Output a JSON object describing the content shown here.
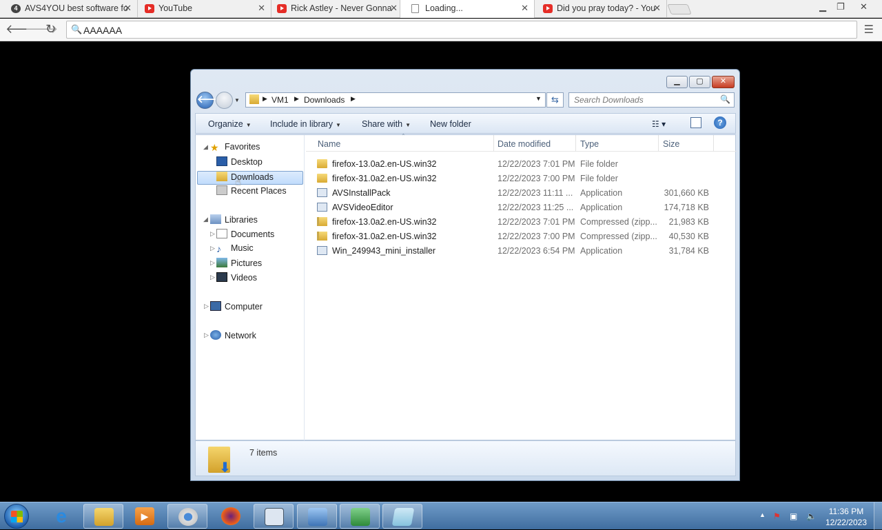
{
  "browser": {
    "tabs": [
      {
        "title": "AVS4YOU best software fo",
        "favicon": "avs-icon"
      },
      {
        "title": "YouTube",
        "favicon": "youtube-icon"
      },
      {
        "title": "Rick Astley - Never Gonna",
        "favicon": "youtube-icon"
      },
      {
        "title": "Loading...",
        "favicon": "document-icon"
      },
      {
        "title": "Did you pray today? - You",
        "favicon": "youtube-icon"
      }
    ],
    "active_tab": 3,
    "omnibox_value": "AAAAAA"
  },
  "explorer": {
    "breadcrumb": [
      "VM1",
      "Downloads"
    ],
    "search_placeholder": "Search Downloads",
    "commands": {
      "organize": "Organize",
      "include_in_library": "Include in library",
      "share_with": "Share with",
      "new_folder": "New folder"
    },
    "nav": {
      "favorites": "Favorites",
      "desktop": "Desktop",
      "downloads": "Downloads",
      "recent_places": "Recent Places",
      "libraries": "Libraries",
      "documents": "Documents",
      "music": "Music",
      "pictures": "Pictures",
      "videos": "Videos",
      "computer": "Computer",
      "network": "Network"
    },
    "columns": {
      "name": "Name",
      "date_modified": "Date modified",
      "type": "Type",
      "size": "Size"
    },
    "files": [
      {
        "name": "firefox-13.0a2.en-US.win32",
        "date": "12/22/2023 7:01 PM",
        "type": "File folder",
        "size": "",
        "icon": "folder-icon"
      },
      {
        "name": "firefox-31.0a2.en-US.win32",
        "date": "12/22/2023 7:00 PM",
        "type": "File folder",
        "size": "",
        "icon": "folder-icon"
      },
      {
        "name": "AVSInstallPack",
        "date": "12/22/2023 11:11 ...",
        "type": "Application",
        "size": "301,660 KB",
        "icon": "application-icon"
      },
      {
        "name": "AVSVideoEditor",
        "date": "12/22/2023 11:25 ...",
        "type": "Application",
        "size": "174,718 KB",
        "icon": "application-icon"
      },
      {
        "name": "firefox-13.0a2.en-US.win32",
        "date": "12/22/2023 7:01 PM",
        "type": "Compressed (zipp...",
        "size": "21,983 KB",
        "icon": "zip-folder-icon"
      },
      {
        "name": "firefox-31.0a2.en-US.win32",
        "date": "12/22/2023 7:00 PM",
        "type": "Compressed (zipp...",
        "size": "40,530 KB",
        "icon": "zip-folder-icon"
      },
      {
        "name": "Win_249943_mini_installer",
        "date": "12/22/2023 6:54 PM",
        "type": "Application",
        "size": "31,784 KB",
        "icon": "installer-icon"
      }
    ],
    "status_count": "7 items"
  },
  "taskbar": {
    "clock_time": "11:36 PM",
    "clock_date": "12/22/2023"
  }
}
